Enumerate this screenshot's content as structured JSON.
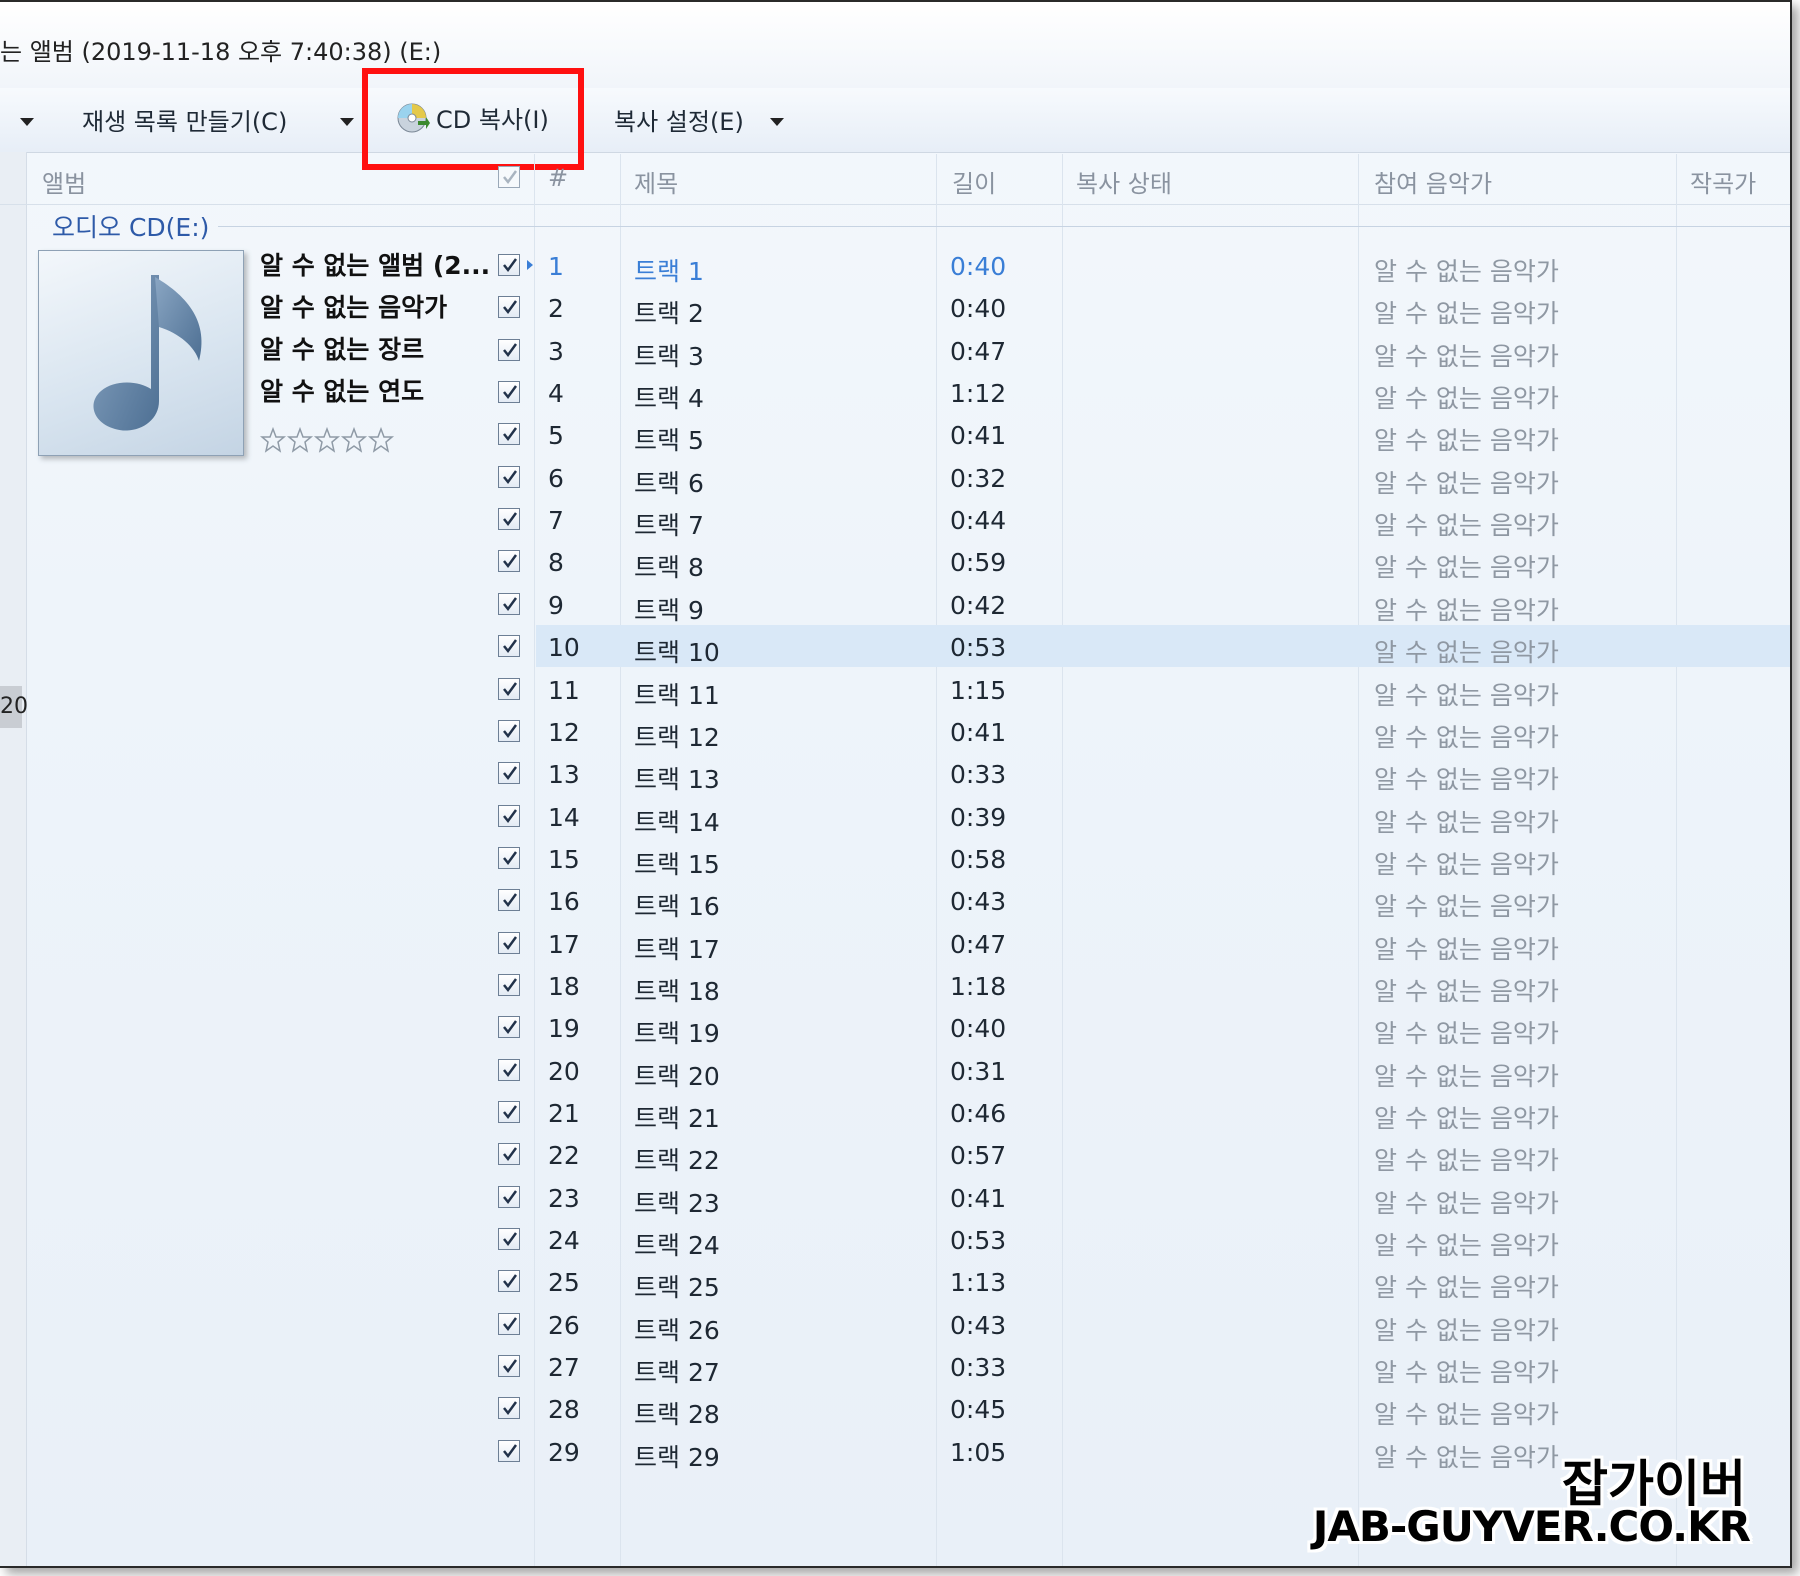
{
  "window": {
    "title": "는 앨범 (2019-11-18 오후 7:40:38) (E:)"
  },
  "toolbar": {
    "create_playlist": "재생 목록 만들기(C)",
    "rip_cd": "CD 복사(I)",
    "rip_settings": "복사 설정(E)"
  },
  "headers": {
    "album": "앨범",
    "num": "#",
    "title": "제목",
    "length": "길이",
    "rip_status": "복사 상태",
    "contributing_artist": "참여 음악가",
    "composer": "작곡가"
  },
  "group": {
    "label": "오디오 CD(E:)"
  },
  "gutter": {
    "label": "20"
  },
  "album": {
    "name": "알 수 없는 앨범 (2...",
    "artist": "알 수 없는 음악가",
    "genre": "알 수 없는 장르",
    "year": "알 수 없는 연도",
    "rating": 0
  },
  "tracks": [
    {
      "num": "1",
      "title": "트랙 1",
      "length": "0:40",
      "artist": "알 수 없는 음악가"
    },
    {
      "num": "2",
      "title": "트랙 2",
      "length": "0:40",
      "artist": "알 수 없는 음악가"
    },
    {
      "num": "3",
      "title": "트랙 3",
      "length": "0:47",
      "artist": "알 수 없는 음악가"
    },
    {
      "num": "4",
      "title": "트랙 4",
      "length": "1:12",
      "artist": "알 수 없는 음악가"
    },
    {
      "num": "5",
      "title": "트랙 5",
      "length": "0:41",
      "artist": "알 수 없는 음악가"
    },
    {
      "num": "6",
      "title": "트랙 6",
      "length": "0:32",
      "artist": "알 수 없는 음악가"
    },
    {
      "num": "7",
      "title": "트랙 7",
      "length": "0:44",
      "artist": "알 수 없는 음악가"
    },
    {
      "num": "8",
      "title": "트랙 8",
      "length": "0:59",
      "artist": "알 수 없는 음악가"
    },
    {
      "num": "9",
      "title": "트랙 9",
      "length": "0:42",
      "artist": "알 수 없는 음악가"
    },
    {
      "num": "10",
      "title": "트랙 10",
      "length": "0:53",
      "artist": "알 수 없는 음악가"
    },
    {
      "num": "11",
      "title": "트랙 11",
      "length": "1:15",
      "artist": "알 수 없는 음악가"
    },
    {
      "num": "12",
      "title": "트랙 12",
      "length": "0:41",
      "artist": "알 수 없는 음악가"
    },
    {
      "num": "13",
      "title": "트랙 13",
      "length": "0:33",
      "artist": "알 수 없는 음악가"
    },
    {
      "num": "14",
      "title": "트랙 14",
      "length": "0:39",
      "artist": "알 수 없는 음악가"
    },
    {
      "num": "15",
      "title": "트랙 15",
      "length": "0:58",
      "artist": "알 수 없는 음악가"
    },
    {
      "num": "16",
      "title": "트랙 16",
      "length": "0:43",
      "artist": "알 수 없는 음악가"
    },
    {
      "num": "17",
      "title": "트랙 17",
      "length": "0:47",
      "artist": "알 수 없는 음악가"
    },
    {
      "num": "18",
      "title": "트랙 18",
      "length": "1:18",
      "artist": "알 수 없는 음악가"
    },
    {
      "num": "19",
      "title": "트랙 19",
      "length": "0:40",
      "artist": "알 수 없는 음악가"
    },
    {
      "num": "20",
      "title": "트랙 20",
      "length": "0:31",
      "artist": "알 수 없는 음악가"
    },
    {
      "num": "21",
      "title": "트랙 21",
      "length": "0:46",
      "artist": "알 수 없는 음악가"
    },
    {
      "num": "22",
      "title": "트랙 22",
      "length": "0:57",
      "artist": "알 수 없는 음악가"
    },
    {
      "num": "23",
      "title": "트랙 23",
      "length": "0:41",
      "artist": "알 수 없는 음악가"
    },
    {
      "num": "24",
      "title": "트랙 24",
      "length": "0:53",
      "artist": "알 수 없는 음악가"
    },
    {
      "num": "25",
      "title": "트랙 25",
      "length": "1:13",
      "artist": "알 수 없는 음악가"
    },
    {
      "num": "26",
      "title": "트랙 26",
      "length": "0:43",
      "artist": "알 수 없는 음악가"
    },
    {
      "num": "27",
      "title": "트랙 27",
      "length": "0:33",
      "artist": "알 수 없는 음악가"
    },
    {
      "num": "28",
      "title": "트랙 28",
      "length": "0:45",
      "artist": "알 수 없는 음악가"
    },
    {
      "num": "29",
      "title": "트랙 29",
      "length": "1:05",
      "artist": "알 수 없는 음악가"
    }
  ],
  "selected_track": "10",
  "playing_track": "1",
  "watermark": {
    "line1": "잡가이버",
    "line2": "JAB-GUYVER.CO.KR"
  },
  "colors": {
    "highlight_box": "#ff1010",
    "accent": "#3a7ed6",
    "selected_row": "#d9e8f7"
  },
  "icons": {
    "rip_cd": "cd-rip-icon",
    "album_art": "music-note-icon",
    "checkbox": "check-icon",
    "rating": "star-icon"
  }
}
